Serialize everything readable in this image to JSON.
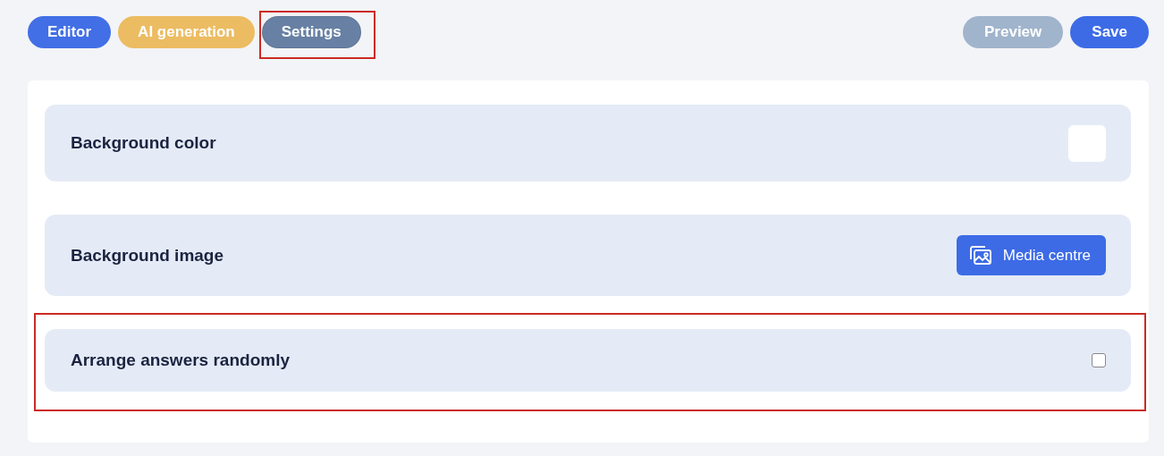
{
  "tabs": [
    {
      "label": "Editor",
      "selected": false,
      "color": "#3d6be6",
      "highlighted": false
    },
    {
      "label": "AI generation",
      "selected": false,
      "color": "#ecbb5e",
      "highlighted": false
    },
    {
      "label": "Settings",
      "selected": true,
      "color": "#6780a3",
      "highlighted": true
    }
  ],
  "actions": [
    {
      "label": "Preview",
      "disabled": true
    },
    {
      "label": "Save",
      "disabled": false
    }
  ],
  "settings": [
    {
      "kind": "color",
      "label": "Background color",
      "color": "#ffffff",
      "highlighted": false
    },
    {
      "kind": "media",
      "label": "Background image",
      "button": "Media centre",
      "highlighted": false
    },
    {
      "kind": "checkbox",
      "label": "Arrange answers randomly",
      "checked": false,
      "highlighted": true
    }
  ]
}
